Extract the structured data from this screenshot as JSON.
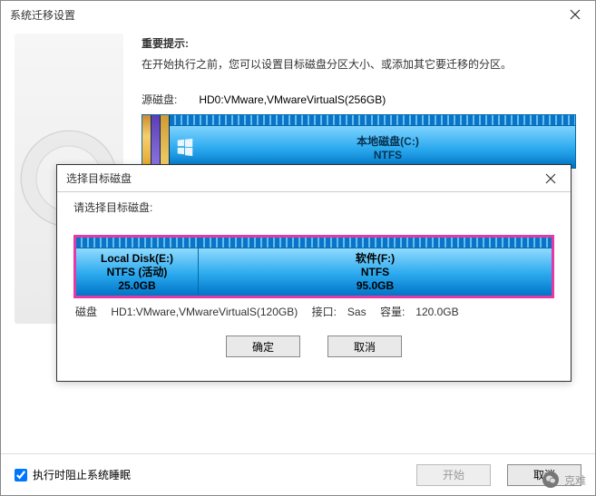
{
  "main": {
    "title": "系统迁移设置",
    "hint_title": "重要提示:",
    "hint_text": "在开始执行之前，您可以设置目标磁盘分区大小、或添加其它要迁移的分区。",
    "source_label": "源磁盘:",
    "source_disk": "HD0:VMware,VMwareVirtualS(256GB)",
    "partition_c": {
      "name": "本地磁盘(C:)",
      "fs": "NTFS"
    }
  },
  "dlg": {
    "title": "选择目标磁盘",
    "prompt": "请选择目标磁盘:",
    "seg1": {
      "name": "Local Disk(E:)",
      "fs": "NTFS (活动)",
      "size": "25.0GB"
    },
    "seg2": {
      "name": "软件(F:)",
      "fs": "NTFS",
      "size": "95.0GB"
    },
    "info_disk_lbl": "磁盘",
    "info_disk": "HD1:VMware,VMwareVirtualS(120GB)",
    "info_if_lbl": "接口:",
    "info_if": "Sas",
    "info_cap_lbl": "容量:",
    "info_cap": "120.0GB",
    "ok": "确定",
    "cancel": "取消"
  },
  "footer": {
    "sleep_toggle": "执行时阻止系统睡眠",
    "start": "开始",
    "cancel": "取消"
  },
  "watermark": "克难"
}
